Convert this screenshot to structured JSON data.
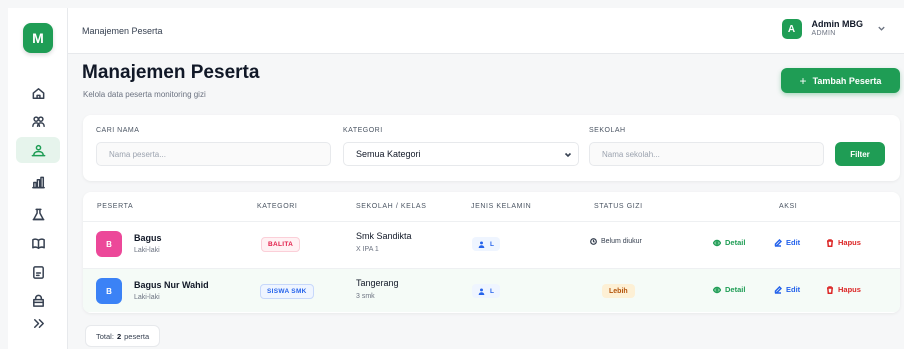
{
  "app": {
    "logo_letter": "M",
    "brand_color": "#1f9d55"
  },
  "sidebar": {
    "items": [
      {
        "icon": "home-icon",
        "active": false
      },
      {
        "icon": "users-icon",
        "active": false
      },
      {
        "icon": "participants-icon",
        "active": true
      },
      {
        "icon": "chart-icon",
        "active": false
      },
      {
        "icon": "flask-icon",
        "active": false
      },
      {
        "icon": "book-icon",
        "active": false
      },
      {
        "icon": "document-icon",
        "active": false
      },
      {
        "icon": "bag-icon",
        "active": false
      },
      {
        "icon": "chevrons-right-icon",
        "active": false
      }
    ]
  },
  "header": {
    "breadcrumb": "Manajemen Peserta",
    "user": {
      "initial": "A",
      "name": "Admin MBG",
      "role": "ADMIN"
    }
  },
  "page": {
    "title": "Manajemen Peserta",
    "subtitle": "Kelola data peserta monitoring gizi",
    "add_button": "Tambah Peserta"
  },
  "filters": {
    "name": {
      "label": "CARI NAMA",
      "placeholder": "Nama peserta..."
    },
    "category": {
      "label": "KATEGORI",
      "value": "Semua Kategori"
    },
    "school": {
      "label": "SEKOLAH",
      "placeholder": "Nama sekolah..."
    },
    "button": "Filter"
  },
  "table": {
    "columns": [
      "PESERTA",
      "KATEGORI",
      "SEKOLAH / KELAS",
      "JENIS KELAMIN",
      "STATUS GIZI",
      "AKSI"
    ],
    "rows": [
      {
        "initial": "B",
        "avatar_color": "#ec4899",
        "name": "Bagus",
        "gender_text": "Laki-laki",
        "category": "BALITA",
        "school": "Smk Sandikta",
        "class": "X IPA 1",
        "gender": "L",
        "status": "Belum diukur"
      },
      {
        "initial": "B",
        "avatar_color": "#3b82f6",
        "name": "Bagus Nur Wahid",
        "gender_text": "Laki-laki",
        "category": "SISWA SMK",
        "school": "Tangerang",
        "class": "3 smk",
        "gender": "L",
        "status": "Lebih"
      }
    ],
    "actions": {
      "detail": "Detail",
      "edit": "Edit",
      "delete": "Hapus"
    }
  },
  "footer": {
    "total_prefix": "Total:",
    "total_count": "2",
    "total_suffix": "peserta"
  }
}
